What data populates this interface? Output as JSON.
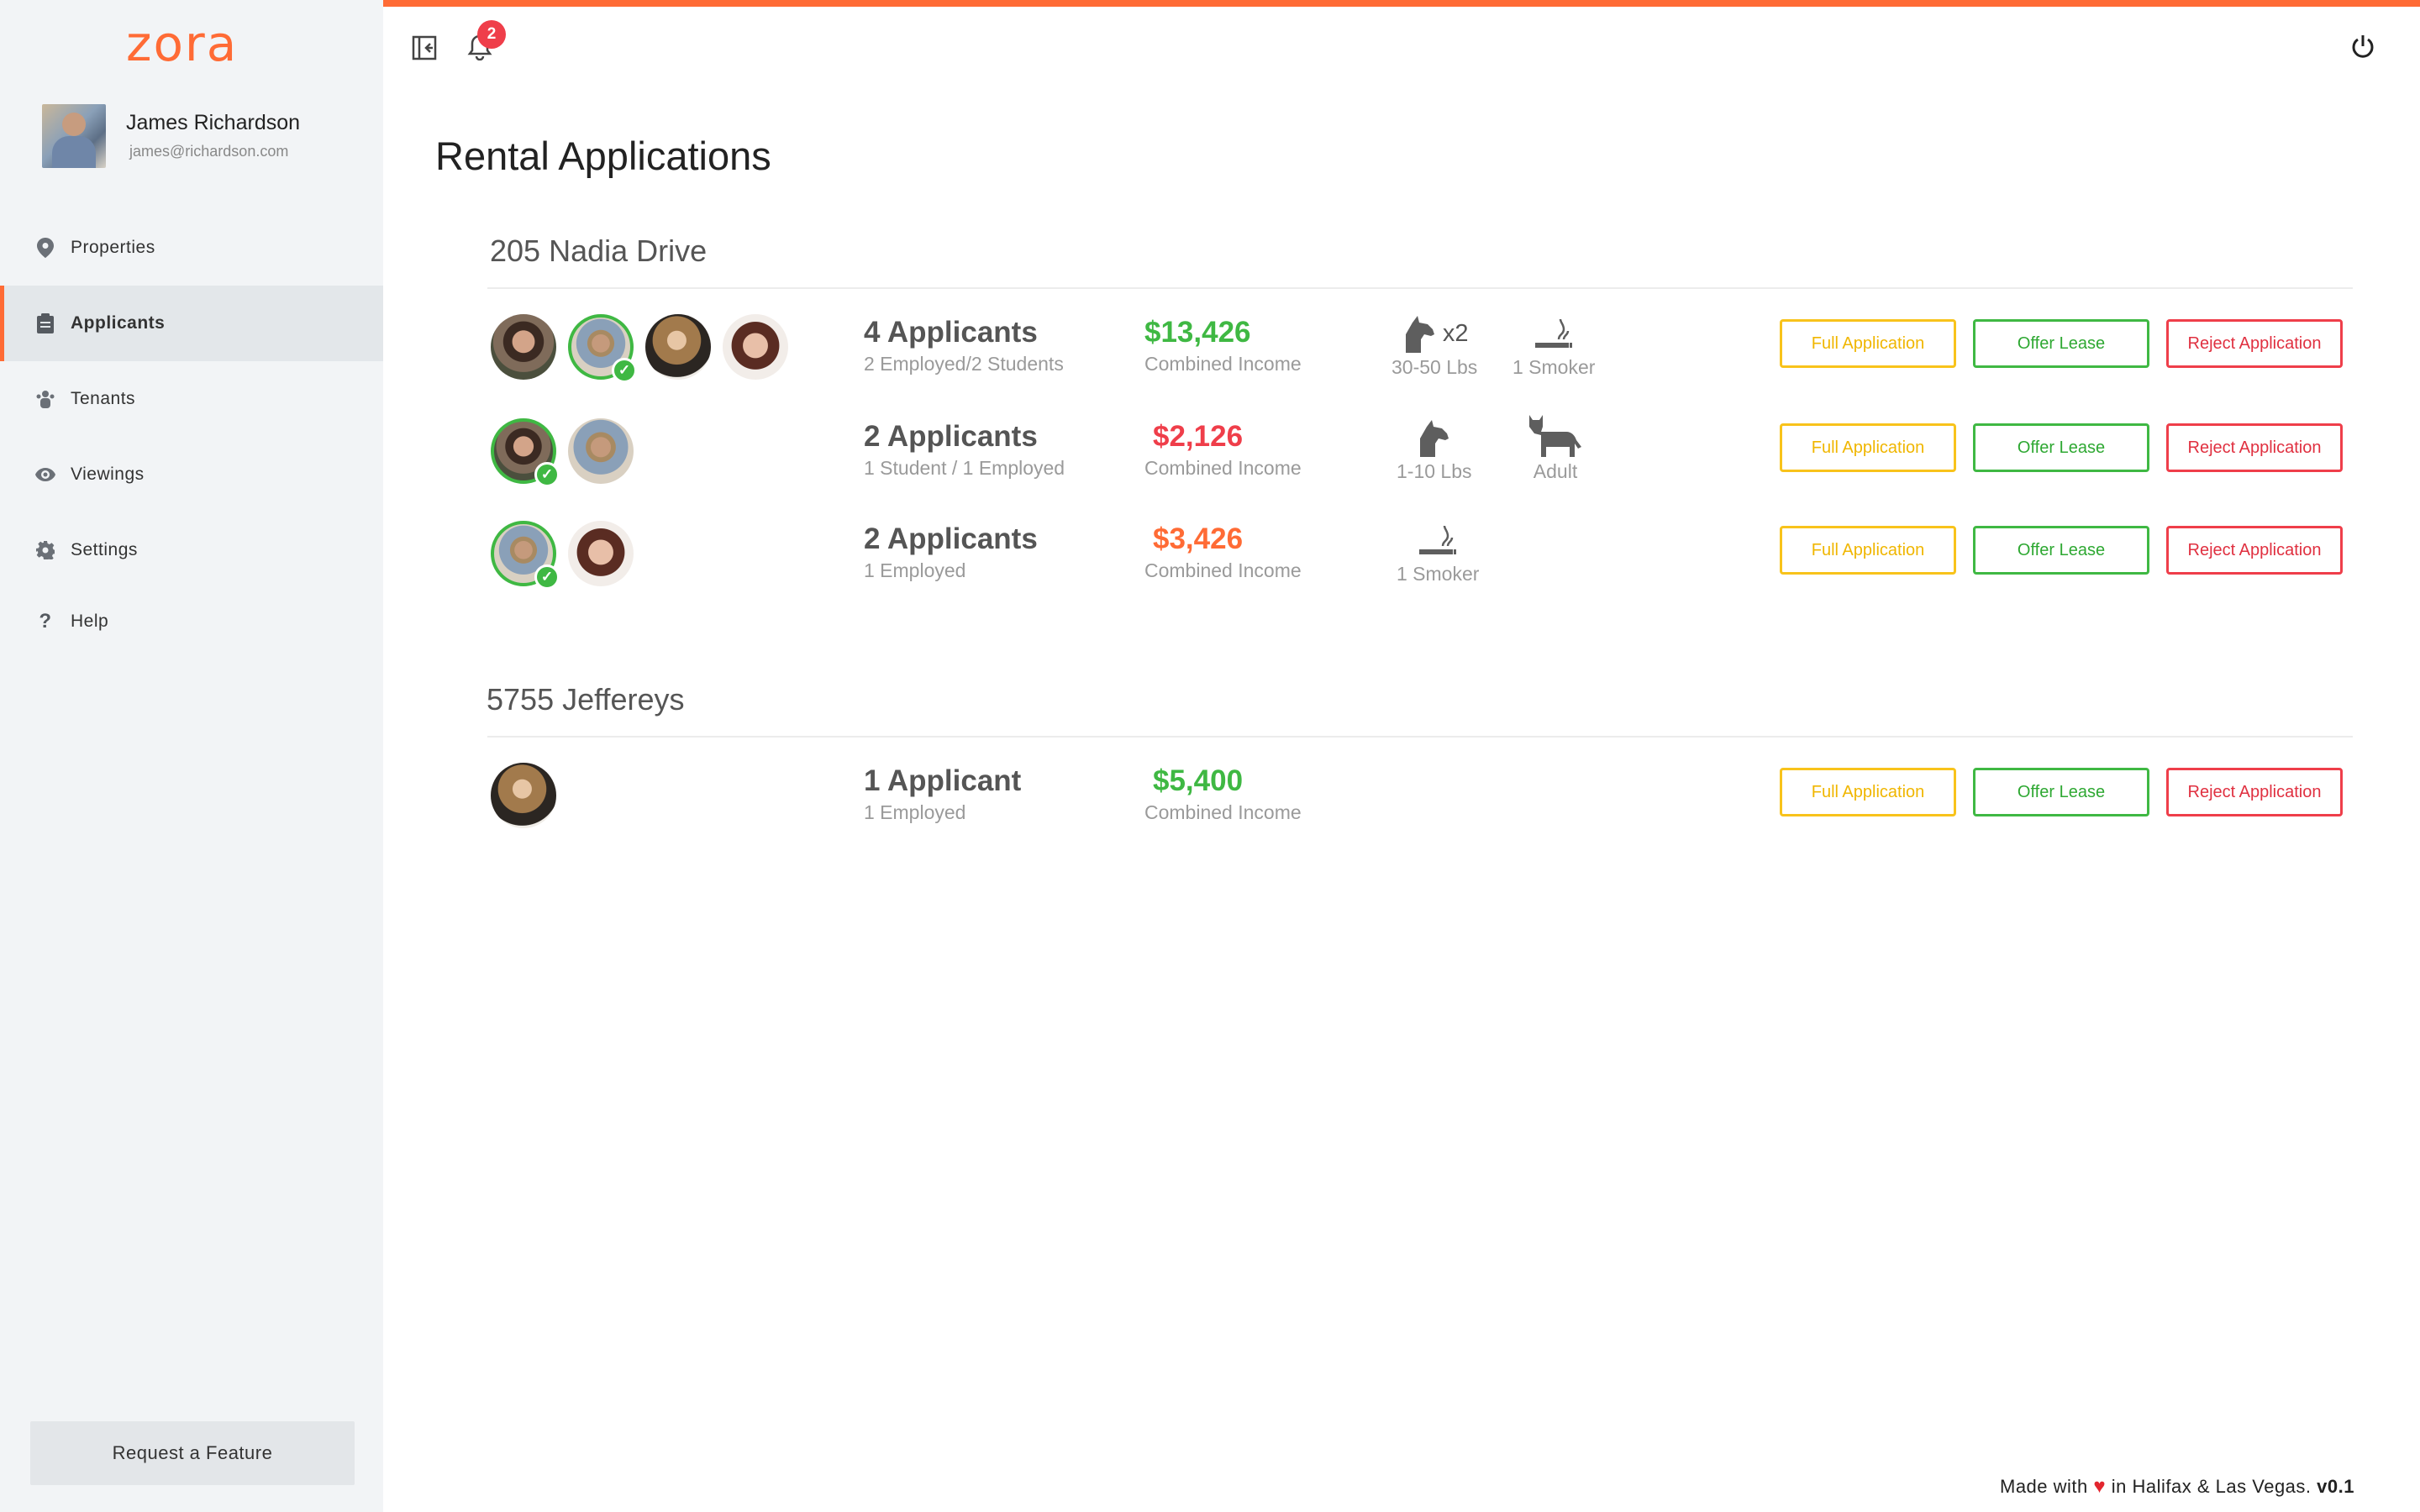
{
  "brand": {
    "logo": "zora",
    "accent": "#ff6b35"
  },
  "user": {
    "name": "James Richardson",
    "email": "james@richardson.com"
  },
  "nav": {
    "items": [
      {
        "label": "Properties",
        "icon": "map-pin-icon"
      },
      {
        "label": "Applicants",
        "icon": "clipboard-icon",
        "active": true
      },
      {
        "label": "Tenants",
        "icon": "users-icon"
      },
      {
        "label": "Viewings",
        "icon": "eye-icon"
      },
      {
        "label": "Settings",
        "icon": "gear-icon"
      },
      {
        "label": "Help",
        "icon": "question-icon"
      }
    ]
  },
  "sidebar_footer": {
    "request_label": "Request a Feature"
  },
  "topbar": {
    "notification_count": "2",
    "icons": [
      "collapse-sidebar-icon",
      "bell-icon",
      "power-icon"
    ]
  },
  "page": {
    "title": "Rental Applications"
  },
  "buttons": {
    "full": "Full Application",
    "offer": "Offer Lease",
    "reject": "Reject Application"
  },
  "properties": [
    {
      "name": "205 Nadia Drive",
      "applications": [
        {
          "count": "4 Applicants",
          "detail": "2 Employed/2 Students",
          "income": "$13,426",
          "income_label": "Combined Income",
          "income_color": "#3fb843",
          "pets": [
            {
              "icon": "dog-icon",
              "multiplier": "x2",
              "label": "30-50 Lbs"
            }
          ],
          "smoker": "1 Smoker"
        },
        {
          "count": "2 Applicants",
          "detail": "1 Student / 1 Employed",
          "income": "$2,126",
          "income_label": "Combined Income",
          "income_color": "#ef3e4a",
          "pets": [
            {
              "icon": "dog-icon",
              "label": "1-10 Lbs"
            },
            {
              "icon": "cat-icon",
              "label": "Adult"
            }
          ]
        },
        {
          "count": "2 Applicants",
          "detail": "1 Employed",
          "income": "$3,426",
          "income_label": "Combined Income",
          "income_color": "#ff6b35",
          "smoker": "1 Smoker"
        }
      ]
    },
    {
      "name": "5755 Jeffereys",
      "applications": [
        {
          "count": "1 Applicant",
          "detail": "1 Employed",
          "income": "$5,400",
          "income_label": "Combined Income",
          "income_color": "#3fb843"
        }
      ]
    }
  ],
  "footer": {
    "made_with": "Made with",
    "heart": "♥",
    "location": "in Halifax & Las Vegas.",
    "version": "v0.1"
  }
}
